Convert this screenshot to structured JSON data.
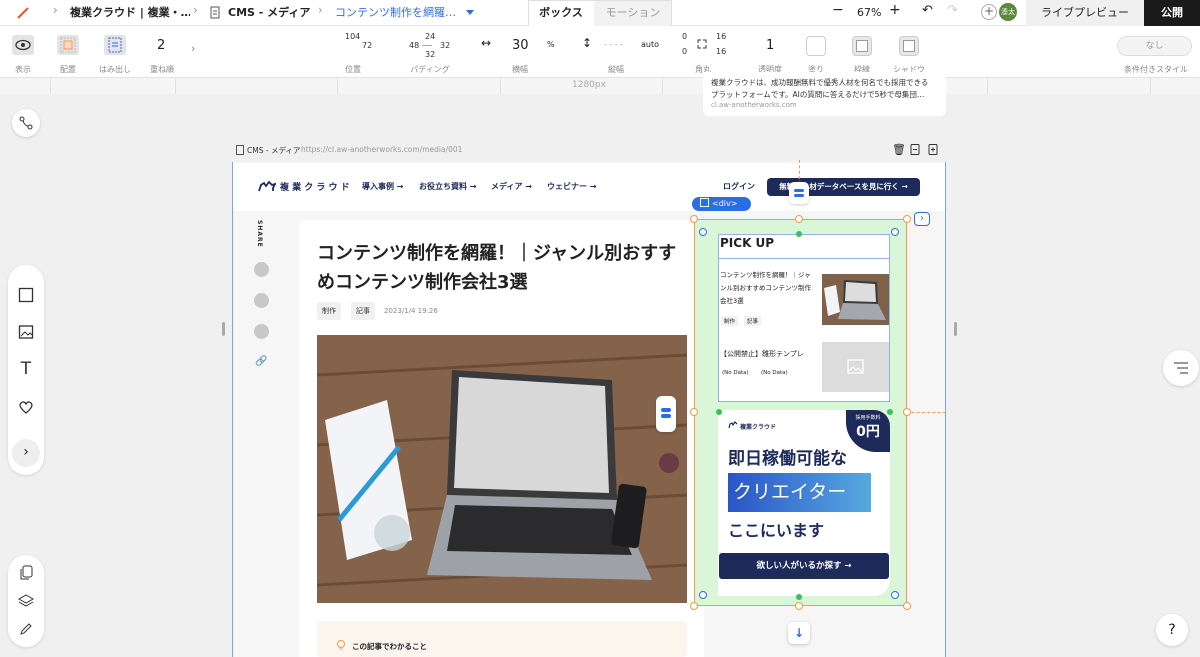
{
  "topbar": {
    "crumb1": "複業クラウド | 複業・…",
    "crumb2": "CMS - メディア",
    "crumb3": "コンテンツ制作を網羅…",
    "tab_box": "ボックス",
    "tab_motion": "モーション",
    "zoom": "67%",
    "avatar": "湊太",
    "live_preview": "ライブプレビュー",
    "publish": "公開"
  },
  "toolbar": {
    "display": "表示",
    "placement": "配置",
    "overflow": "はみ出し",
    "zorder_value": "2",
    "zorder": "重ね順",
    "pos_top": "104",
    "pos_right": "72",
    "position": "位置",
    "pad_top": "24",
    "pad_left": "48",
    "pad_right": "32",
    "pad_bottom": "32",
    "padding": "パディング",
    "width_value": "30",
    "width_unit": "%",
    "width": "横幅",
    "height_value": "- - - -",
    "height_unit": "auto",
    "height": "縦幅",
    "radius_tl": "0",
    "radius_bl": "0",
    "radius_tr": "16",
    "radius_br": "16",
    "radius": "角丸",
    "opacity_value": "1",
    "opacity": "透明度",
    "fill": "塗り",
    "border": "枠線",
    "shadow": "シャドウ",
    "cond_value": "なし",
    "conditional": "条件付きスタイル"
  },
  "canvas": {
    "ruler_label": "1280px",
    "tooltip_line1": "複業クラウドは、成功報酬無料で優秀人材を何名でも採用できる",
    "tooltip_line2": "プラットフォームです。AIの質問に答えるだけで5秒で母集団…",
    "tooltip_url": "cl.aw-anotherworks.com",
    "page_label": "CMS - メディア",
    "page_url": "https://cl.aw-anotherworks.com/media/001",
    "selection_tag": "<div>"
  },
  "site": {
    "logo": "複 業 ク ラ ウ ド",
    "nav": [
      "導入事例 →",
      "お役立ち資料 →",
      "メディア →",
      "ウェビナー →"
    ],
    "login": "ログイン",
    "cta": "無料で人材データベースを見に行く →",
    "share": "SHARE",
    "article_title_1": "コンテンツ制作を網羅！｜ジャンル別おすす",
    "article_title_2": "めコンテンツ制作会社3選",
    "tag1": "制作",
    "tag2": "記事",
    "date": "2023/1/4 19:26",
    "toc_label": "この記事でわかること",
    "pickup_title": "PICK UP",
    "pick1_title_1": "コンテンツ制作を網羅！｜ジャ",
    "pick1_title_2": "ンル別おすすめコンテンツ制作",
    "pick1_title_3": "会社3選",
    "pick1_tag1": "制作",
    "pick1_tag2": "記事",
    "pick2_title": "【公開禁止】雛形テンプレ",
    "pick2_tag1": "(No Data)",
    "pick2_tag2": "(No Data)",
    "banner_logo": "複業クラウド",
    "banner_badge_small": "採用手数料",
    "banner_badge_big": "0円",
    "banner_line1": "即日稼働可能な",
    "banner_line2": "クリエイター",
    "banner_line3": "ここにいます",
    "banner_button": "欲しい人がいるか探す →"
  },
  "help": "?"
}
